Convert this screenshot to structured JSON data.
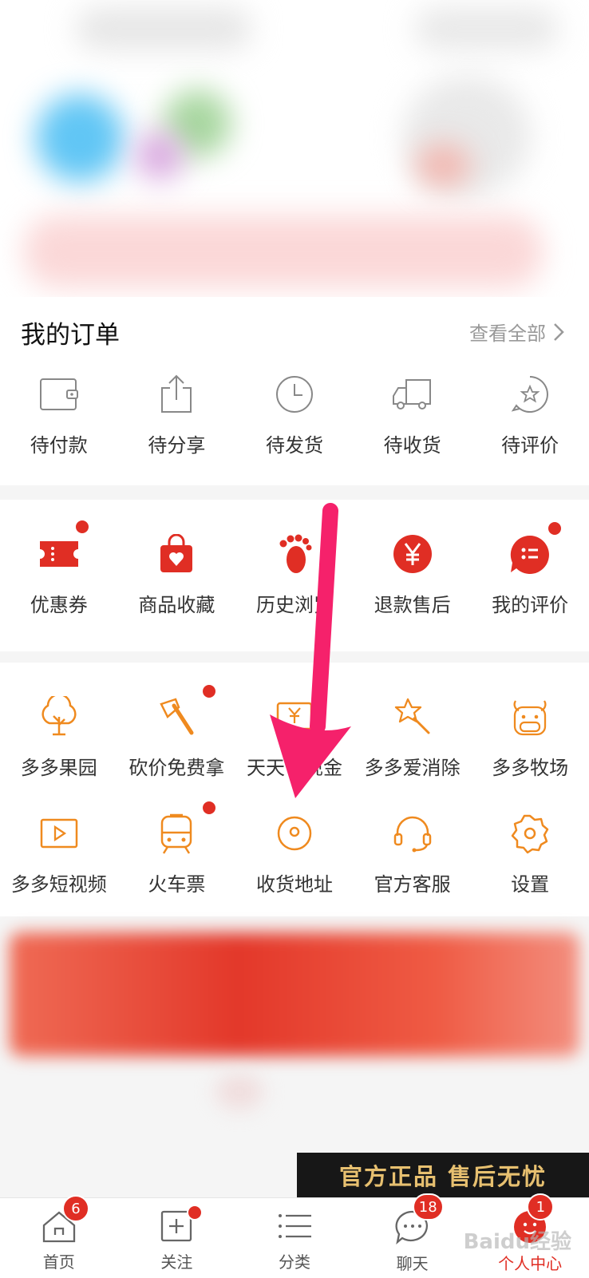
{
  "orders": {
    "title": "我的订单",
    "view_all": "查看全部",
    "items": [
      {
        "label": "待付款",
        "icon": "wallet-icon"
      },
      {
        "label": "待分享",
        "icon": "share-icon"
      },
      {
        "label": "待发货",
        "icon": "clock-icon"
      },
      {
        "label": "待收货",
        "icon": "truck-icon"
      },
      {
        "label": "待评价",
        "icon": "star-review-icon"
      }
    ]
  },
  "services": {
    "items": [
      {
        "label": "优惠券",
        "icon": "coupon-icon",
        "dot": true
      },
      {
        "label": "商品收藏",
        "icon": "favorite-bag-icon",
        "dot": false
      },
      {
        "label": "历史浏览",
        "icon": "footprint-icon",
        "dot": false
      },
      {
        "label": "退款售后",
        "icon": "yuan-refund-icon",
        "dot": false
      },
      {
        "label": "我的评价",
        "icon": "comment-icon",
        "dot": true
      }
    ]
  },
  "tools": {
    "row1": [
      {
        "label": "多多果园",
        "icon": "tree-icon",
        "dot": false
      },
      {
        "label": "砍价免费拿",
        "icon": "axe-icon",
        "dot": true
      },
      {
        "label": "天天领现金",
        "icon": "cash-icon",
        "dot": false
      },
      {
        "label": "多多爱消除",
        "icon": "magic-wand-icon",
        "dot": false
      },
      {
        "label": "多多牧场",
        "icon": "cow-icon",
        "dot": false
      }
    ],
    "row2": [
      {
        "label": "多多短视频",
        "icon": "video-icon",
        "dot": false
      },
      {
        "label": "火车票",
        "icon": "train-icon",
        "dot": true
      },
      {
        "label": "收货地址",
        "icon": "location-icon",
        "dot": false
      },
      {
        "label": "官方客服",
        "icon": "headset-icon",
        "dot": false
      },
      {
        "label": "设置",
        "icon": "settings-gear-icon",
        "dot": false
      }
    ]
  },
  "promo": {
    "text": "官方正品 售后无忧"
  },
  "tabbar": {
    "items": [
      {
        "label": "首页",
        "icon": "home-icon",
        "badge": "6"
      },
      {
        "label": "关注",
        "icon": "follow-icon",
        "badge": ""
      },
      {
        "label": "分类",
        "icon": "category-list-icon",
        "badge": ""
      },
      {
        "label": "聊天",
        "icon": "chat-icon",
        "badge": "18"
      },
      {
        "label": "个人中心",
        "icon": "profile-icon",
        "badge": "1"
      }
    ]
  },
  "watermark": "Baidu经验",
  "colors": {
    "accent": "#e02e24",
    "orange": "#ef8a1f",
    "annotation_arrow": "#f5216b"
  }
}
